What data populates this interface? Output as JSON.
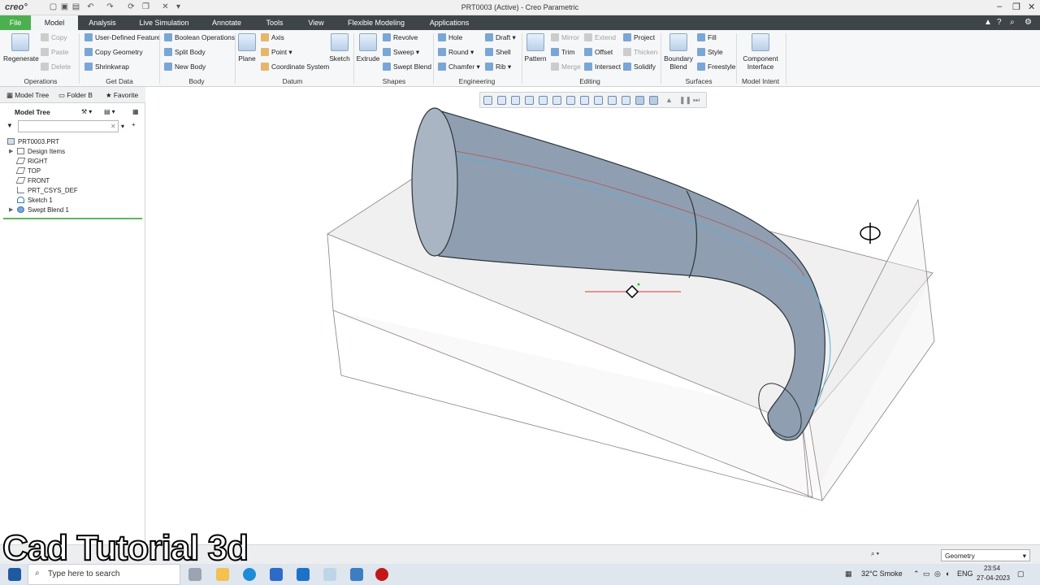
{
  "title_bar": {
    "logo": "creo°",
    "window_title": "PRT0003 (Active) - Creo Parametric"
  },
  "menu": {
    "tabs": [
      "File",
      "Model",
      "Analysis",
      "Live Simulation",
      "Annotate",
      "Tools",
      "View",
      "Flexible Modeling",
      "Applications"
    ],
    "active": "Model"
  },
  "ribbon": {
    "regenerate": "Regenerate",
    "operations": {
      "copy": "Copy",
      "paste": "Paste",
      "delete": "Delete",
      "group": "Operations"
    },
    "get_data": {
      "udf": "User-Defined Feature",
      "copy_geometry": "Copy Geometry",
      "shrinkwrap": "Shrinkwrap",
      "group": "Get Data"
    },
    "body": {
      "boolean": "Boolean Operations",
      "split": "Split Body",
      "new": "New Body",
      "group": "Body"
    },
    "datum": {
      "plane": "Plane",
      "axis": "Axis",
      "point": "Point",
      "csys": "Coordinate System",
      "sketch": "Sketch",
      "group": "Datum"
    },
    "shapes": {
      "extrude": "Extrude",
      "revolve": "Revolve",
      "sweep": "Sweep",
      "swept_blend": "Swept Blend",
      "group": "Shapes"
    },
    "engineering": {
      "hole": "Hole",
      "round": "Round",
      "chamfer": "Chamfer",
      "draft": "Draft",
      "shell": "Shell",
      "rib": "Rib",
      "group": "Engineering"
    },
    "editing": {
      "pattern": "Pattern",
      "mirror": "Mirror",
      "trim": "Trim",
      "merge": "Merge",
      "extend": "Extend",
      "offset": "Offset",
      "intersect": "Intersect",
      "project": "Project",
      "thicken": "Thicken",
      "solidify": "Solidify",
      "group": "Editing"
    },
    "surfaces": {
      "boundary_blend": "Boundary Blend",
      "fill": "Fill",
      "style": "Style",
      "freestyle": "Freestyle",
      "group": "Surfaces"
    },
    "model_intent": {
      "component_interface": "Component Interface",
      "group": "Model Intent"
    }
  },
  "left_panel": {
    "tabs": [
      "Model Tree",
      "Folder B",
      "Favorite"
    ],
    "header": "Model Tree",
    "tree": [
      {
        "label": "PRT0003.PRT",
        "expand": false
      },
      {
        "label": "Design Items",
        "expand": true
      },
      {
        "label": "RIGHT",
        "expand": false
      },
      {
        "label": "TOP",
        "expand": false
      },
      {
        "label": "FRONT",
        "expand": false
      },
      {
        "label": "PRT_CSYS_DEF",
        "expand": false
      },
      {
        "label": "Sketch 1",
        "expand": false
      },
      {
        "label": "Swept Blend 1",
        "expand": true
      }
    ]
  },
  "status_bar": {
    "filter": "Geometry"
  },
  "taskbar": {
    "search_placeholder": "Type here to search",
    "weather": "32°C Smoke",
    "lang": "ENG",
    "time": "23:54",
    "date": "27-04-2023"
  },
  "watermark": "Cad Tutorial 3d",
  "colors": {
    "file_tab": "#4caf50",
    "menubar": "#3e4549",
    "model_fill": "#8f9fb1"
  }
}
